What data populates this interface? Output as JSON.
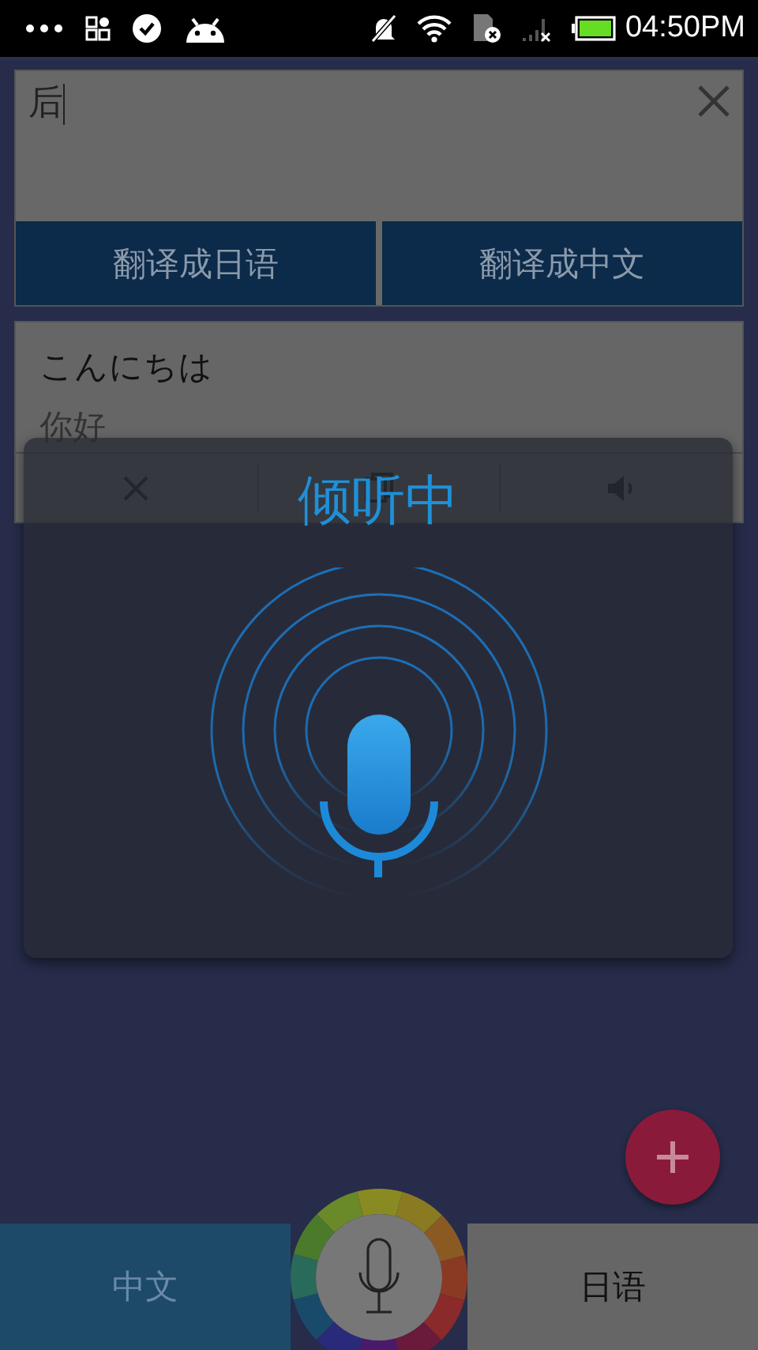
{
  "status_bar": {
    "time": "04:50PM"
  },
  "input": {
    "value": "后"
  },
  "buttons": [
    {
      "label": "翻译成日语"
    },
    {
      "label": "翻译成中文"
    }
  ],
  "result": {
    "source": "こんにちは",
    "translation": "你好"
  },
  "dialog": {
    "title": "倾听中"
  },
  "languages": [
    {
      "label": "中文",
      "selected": true
    },
    {
      "label": "日语",
      "selected": false
    }
  ]
}
